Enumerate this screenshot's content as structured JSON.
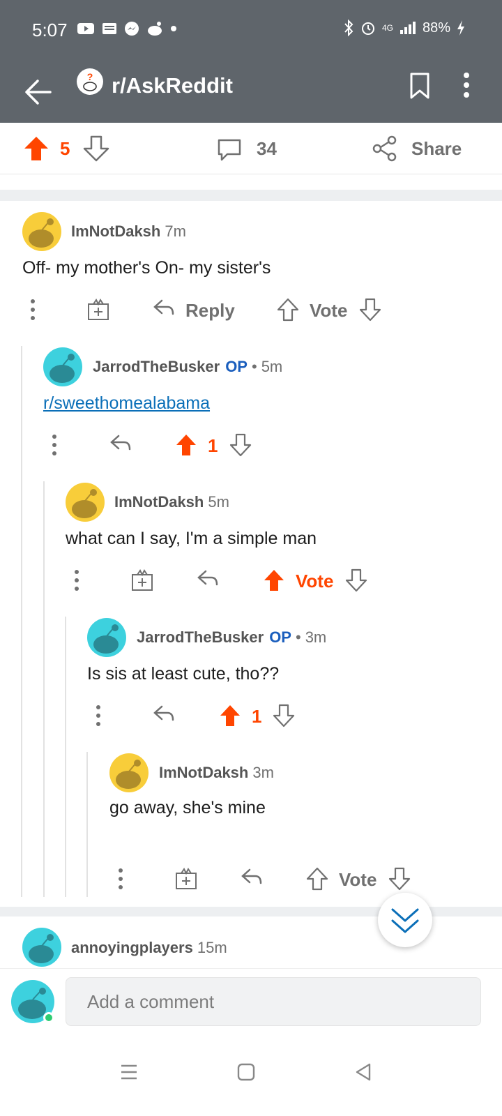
{
  "status": {
    "time": "5:07",
    "battery": "88%",
    "network": "4G"
  },
  "header": {
    "subreddit": "r/AskReddit"
  },
  "post_actions": {
    "score": "5",
    "comments": "34",
    "share": "Share"
  },
  "comments": [
    {
      "user": "ImNotDaksh",
      "op": "",
      "time": "7m",
      "text": "Off- my mother's On- my sister's",
      "reply": "Reply",
      "vote": "Vote"
    },
    {
      "user": "JarrodTheBusker",
      "op": "OP",
      "dot": "•",
      "time": "5m",
      "link": "r/sweethomealabama",
      "score": "1"
    },
    {
      "user": "ImNotDaksh",
      "time": "5m",
      "text": "what can I say, I'm a simple man",
      "vote": "Vote"
    },
    {
      "user": "JarrodTheBusker",
      "op": "OP",
      "dot": "•",
      "time": "3m",
      "text": "Is sis at least cute, tho??",
      "score": "1"
    },
    {
      "user": "ImNotDaksh",
      "time": "3m",
      "text": "go away, she's mine",
      "vote": "Vote"
    },
    {
      "user": "annoyingplayers",
      "time": "15m"
    }
  ],
  "composer": {
    "placeholder": "Add a comment"
  },
  "colors": {
    "upvote": "#ff4500",
    "header_bg": "#5f656b",
    "op": "#1a5ebd",
    "link": "#0b6fb8"
  }
}
